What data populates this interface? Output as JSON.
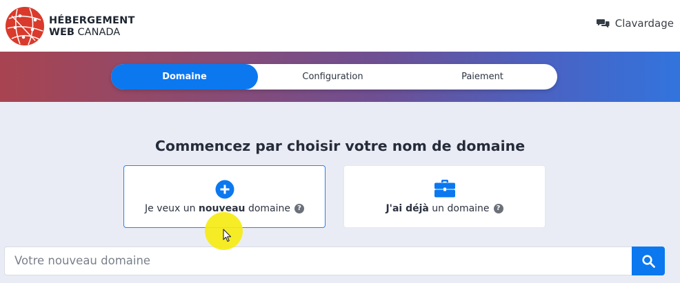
{
  "brand": {
    "line1": "HÉBERGEMENT",
    "line2_bold": "WEB",
    "line2_rest": " CANADA",
    "logo_icon": "globe-network-logo",
    "logo_color": "#d93a2b"
  },
  "chat": {
    "label": "Clavardage",
    "icon": "chat-bubbles-icon"
  },
  "steps": [
    {
      "label": "Domaine",
      "active": true
    },
    {
      "label": "Configuration",
      "active": false
    },
    {
      "label": "Paiement",
      "active": false
    }
  ],
  "heading": "Commencez par choisir votre nom de domaine",
  "options": {
    "new": {
      "prefix": "Je veux un ",
      "bold": "nouveau",
      "suffix": " domaine",
      "help": "?",
      "icon": "plus-circle-icon"
    },
    "existing": {
      "bold": "J'ai déjà",
      "suffix": " un domaine",
      "help": "?",
      "icon": "briefcase-icon"
    }
  },
  "search": {
    "placeholder": "Votre nouveau domaine",
    "icon": "search-icon"
  },
  "colors": {
    "accent": "#0b78f0",
    "banner_start": "#a84451",
    "banner_end": "#3274dd"
  }
}
